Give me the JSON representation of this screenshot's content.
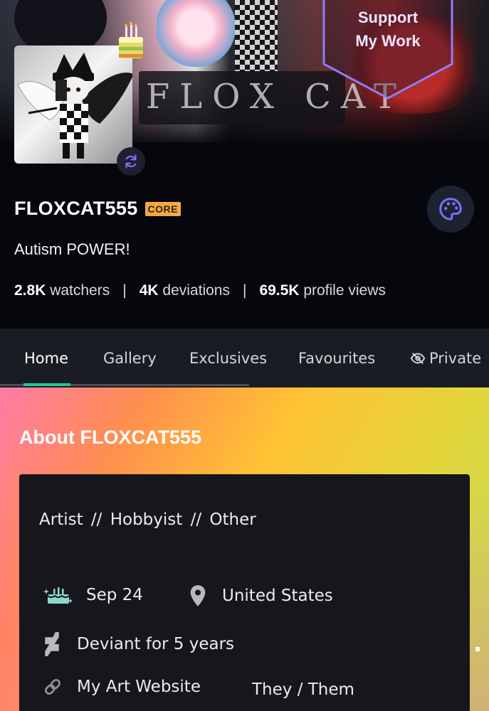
{
  "banner": {
    "text": "FLOX CAT",
    "support_line1": "Support",
    "support_line2": "My Work"
  },
  "profile": {
    "username": "FLOXCAT555",
    "badge": "CORE",
    "tagline": "Autism POWER!",
    "stats": {
      "watchers_value": "2.8K",
      "watchers_label": "watchers",
      "deviations_value": "4K",
      "deviations_label": "deviations",
      "views_value": "69.5K",
      "views_label": "profile views",
      "separator": "|"
    }
  },
  "tabs": [
    {
      "label": "Home",
      "active": true
    },
    {
      "label": "Gallery",
      "active": false
    },
    {
      "label": "Exclusives",
      "active": false
    },
    {
      "label": "Favourites",
      "active": false
    },
    {
      "label": "Private",
      "active": false
    }
  ],
  "about": {
    "title": "About FLOXCAT555",
    "roles": "Artist  //  Hobbyist  //  Other",
    "birthday": "Sep 24",
    "location": "United States",
    "deviant_for": "Deviant for 5 years",
    "website": "My Art Website",
    "pronouns": "They / Them"
  },
  "colors": {
    "accent_purple": "#6d5ef8",
    "tab_underline": "#21c793",
    "core_badge": "#f4a84a"
  },
  "icons": {
    "birthday": "cake-icon",
    "location": "location-pin-icon",
    "deviant": "deviantart-logo-icon",
    "website": "link-icon",
    "private": "eye-off-icon",
    "palette": "palette-icon",
    "swap": "refresh-icon"
  }
}
